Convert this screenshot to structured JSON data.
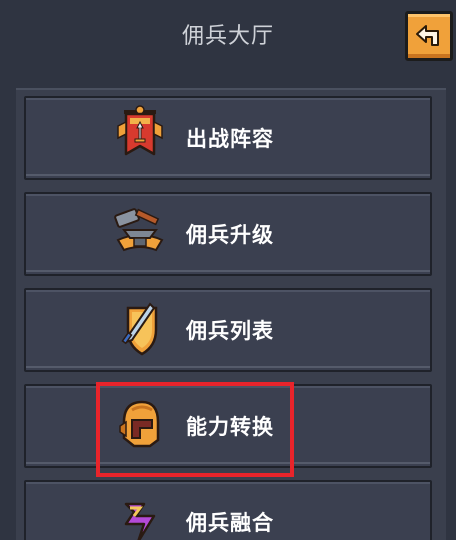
{
  "header": {
    "title": "佣兵大厅",
    "back_icon": "back-arrow-icon"
  },
  "menu": [
    {
      "label": "出战阵容",
      "icon": "banner-sword-icon"
    },
    {
      "label": "佣兵升级",
      "icon": "anvil-hammer-icon"
    },
    {
      "label": "佣兵列表",
      "icon": "shield-sword-icon"
    },
    {
      "label": "能力转换",
      "icon": "helmet-icon"
    },
    {
      "label": "佣兵融合",
      "icon": "fusion-icon"
    }
  ],
  "highlight": {
    "target": "能力转换",
    "color": "#e8242b"
  },
  "colors": {
    "background": "#2f3441",
    "button": "#3b4050",
    "accent": "#f0a13a"
  }
}
